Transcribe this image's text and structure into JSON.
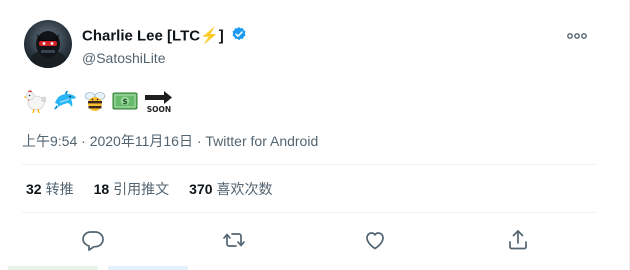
{
  "author": {
    "display_name": "Charlie Lee [LTC⚡]",
    "handle": "@SatoshiLite",
    "verified": true
  },
  "tweet": {
    "emojis": [
      "rooster",
      "dolphin",
      "bee",
      "dollar-banknote",
      "soon-arrow"
    ],
    "soon_label": "SOON",
    "time": "上午9:54",
    "separator": "·",
    "date": "2020年11月16日",
    "source": "Twitter for Android"
  },
  "stats": {
    "retweets_count": "32",
    "retweets_label": "转推",
    "quotes_count": "18",
    "quotes_label": "引用推文",
    "likes_count": "370",
    "likes_label": "喜欢次数"
  },
  "actions": [
    "reply-icon",
    "retweet-icon",
    "like-icon",
    "share-icon"
  ],
  "colors": {
    "primary_text": "#0f1419",
    "secondary_text": "#536471",
    "verified_blue": "#1d9bf0",
    "divider": "#eff3f4"
  }
}
